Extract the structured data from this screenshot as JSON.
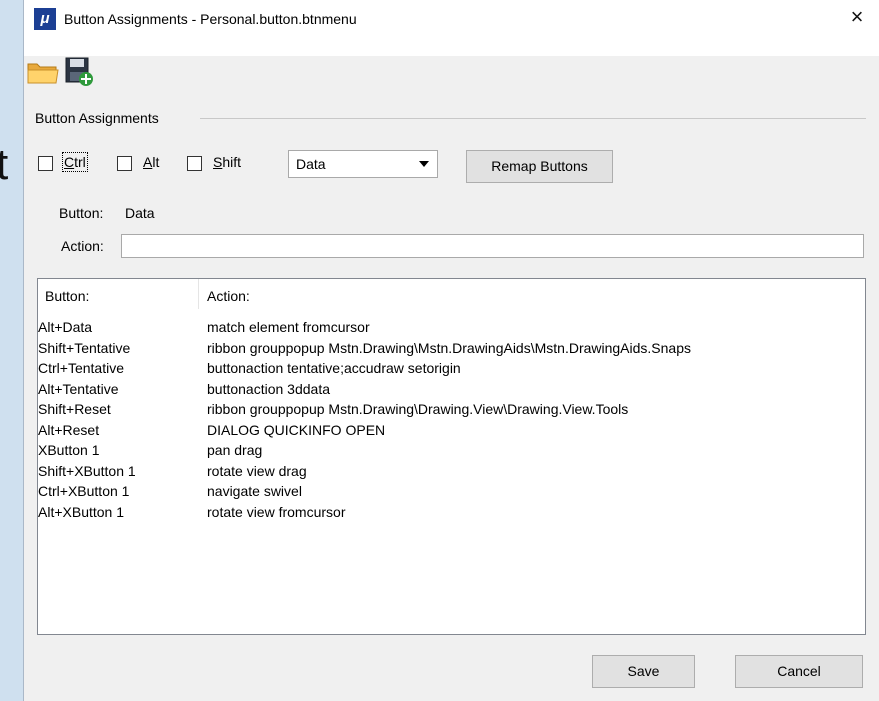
{
  "window": {
    "title": "Button Assignments - Personal.button.btnmenu",
    "app_icon_glyph": "μ",
    "close_glyph": "×"
  },
  "background": {
    "partial_text": "t"
  },
  "toolbar": {
    "icons": [
      "folder-open-icon",
      "save-disk-icon"
    ]
  },
  "group": {
    "label": "Button Assignments"
  },
  "modifiers": [
    {
      "label": "Ctrl",
      "underline": "C",
      "rest": "trl",
      "checked": false
    },
    {
      "label": "Alt",
      "underline": "A",
      "rest": "lt",
      "checked": false
    },
    {
      "label": "Shift",
      "underline": "S",
      "rest": "hift",
      "checked": false
    }
  ],
  "button_select": {
    "value": "Data"
  },
  "remap_label": "Remap Buttons",
  "button_info": {
    "label": "Button:",
    "value": "Data"
  },
  "action": {
    "label": "Action:",
    "value": ""
  },
  "list": {
    "columns": [
      "Button:",
      "Action:"
    ],
    "rows": [
      {
        "button": "Alt+Data",
        "action": "match element fromcursor"
      },
      {
        "button": "Shift+Tentative",
        "action": "ribbon grouppopup Mstn.Drawing\\Mstn.DrawingAids\\Mstn.DrawingAids.Snaps"
      },
      {
        "button": "Ctrl+Tentative",
        "action": "buttonaction tentative;accudraw setorigin"
      },
      {
        "button": "Alt+Tentative",
        "action": "buttonaction 3ddata"
      },
      {
        "button": "Shift+Reset",
        "action": "ribbon grouppopup Mstn.Drawing\\Drawing.View\\Drawing.View.Tools"
      },
      {
        "button": "Alt+Reset",
        "action": "DIALOG QUICKINFO OPEN"
      },
      {
        "button": "XButton 1",
        "action": "pan drag"
      },
      {
        "button": "Shift+XButton 1",
        "action": "rotate view drag"
      },
      {
        "button": "Ctrl+XButton 1",
        "action": "navigate swivel"
      },
      {
        "button": "Alt+XButton 1",
        "action": "rotate view fromcursor"
      }
    ]
  },
  "footer": {
    "save_label": "Save",
    "cancel_label": "Cancel"
  }
}
